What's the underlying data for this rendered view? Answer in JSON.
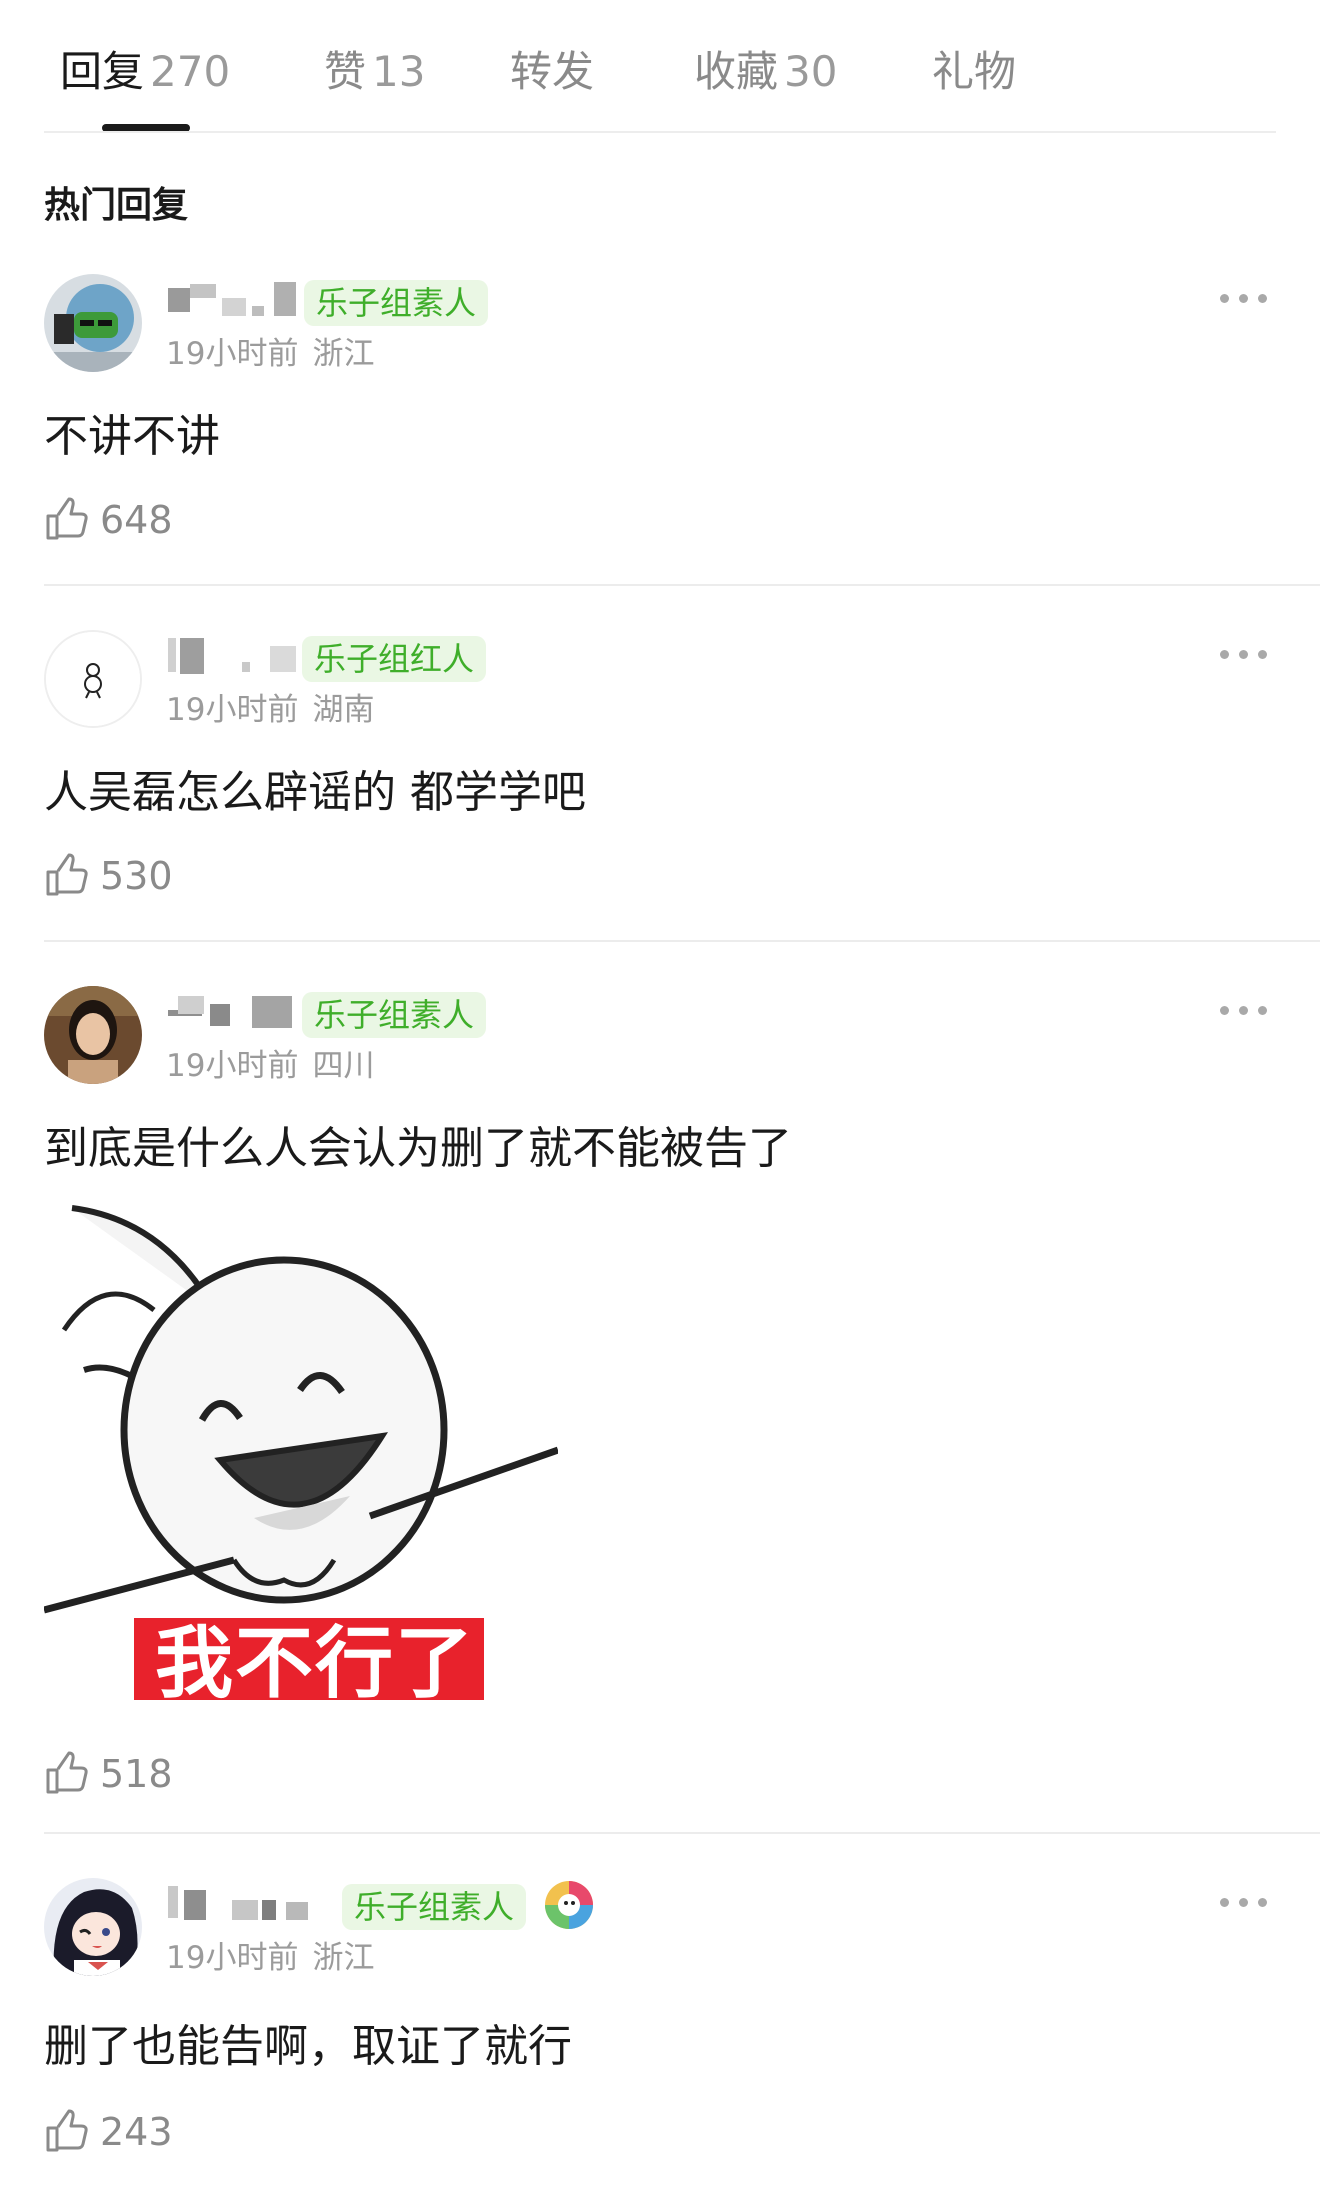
{
  "tabs": [
    {
      "label": "回复",
      "count": "270"
    },
    {
      "label": "赞",
      "count": "13"
    },
    {
      "label": "转发",
      "count": ""
    },
    {
      "label": "收藏",
      "count": "30"
    },
    {
      "label": "礼物",
      "count": ""
    }
  ],
  "section_title": "热门回复",
  "comments": [
    {
      "badge": "乐子组素人",
      "time": "19小时前",
      "location": "浙江",
      "text": "不讲不讲",
      "likes": "648"
    },
    {
      "badge": "乐子组红人",
      "time": "19小时前",
      "location": "湖南",
      "text": "人吴磊怎么辟谣的 都学学吧",
      "likes": "530"
    },
    {
      "badge": "乐子组素人",
      "time": "19小时前",
      "location": "四川",
      "text": "到底是什么人会认为删了就不能被告了",
      "likes": "518",
      "image_caption": "我不行了"
    },
    {
      "badge": "乐子组素人",
      "time": "19小时前",
      "location": "浙江",
      "text": "删了也能告啊，取证了就行",
      "likes": "243"
    }
  ],
  "colors": {
    "badge_text": "#3fae2a",
    "badge_bg": "#eaf7e4",
    "meta": "#9b9b9b",
    "caption_bg": "#e8222c"
  }
}
